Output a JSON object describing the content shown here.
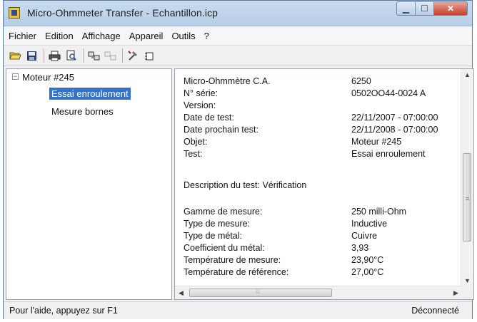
{
  "window": {
    "title": "Micro-Ohmmeter Transfer - Echantillon.icp"
  },
  "menu": [
    "Fichier",
    "Edition",
    "Affichage",
    "Appareil",
    "Outils",
    "?"
  ],
  "toolbar": {
    "icons": [
      "open-folder-icon",
      "save-icon",
      "print-icon",
      "print-preview-icon",
      "transfer-icon",
      "transfer-disabled-icon",
      "tools-icon",
      "settings-icon"
    ]
  },
  "tree": {
    "root": "Moteur #245",
    "toggle": "−",
    "children": [
      "Essai enroulement",
      "Mesure bornes"
    ]
  },
  "details": {
    "rows": [
      {
        "label": "Micro-Ohmmètre C.A.",
        "value": "6250"
      },
      {
        "label": "N° série:",
        "value": "0502OO44-0024 A"
      },
      {
        "label": "Version:",
        "value": ""
      },
      {
        "label": "Date de test:",
        "value": "22/11/2007 - 07:00:00"
      },
      {
        "label": "Date prochain test:",
        "value": "22/11/2008 - 07:00:00"
      },
      {
        "label": "Objet:",
        "value": "Moteur #245"
      },
      {
        "label": "Test:",
        "value": "Essai enroulement"
      }
    ],
    "description": "Description du test: Vérification",
    "rows2": [
      {
        "label": "Gamme de mesure:",
        "value": "250 milli-Ohm"
      },
      {
        "label": "Type de mesure:",
        "value": "Inductive"
      },
      {
        "label": "Type de métal:",
        "value": "Cuivre"
      },
      {
        "label": "Coefficient du métal:",
        "value": "3,93"
      },
      {
        "label": "Température de mesure:",
        "value": "23,90°C"
      },
      {
        "label": "Température de référence:",
        "value": "27,00°C"
      }
    ]
  },
  "status": {
    "left": "Pour l'aide, appuyez sur F1",
    "right": "Déconnecté"
  },
  "colors": {
    "selection": "#3572c8",
    "close_button": "#c7402e"
  }
}
